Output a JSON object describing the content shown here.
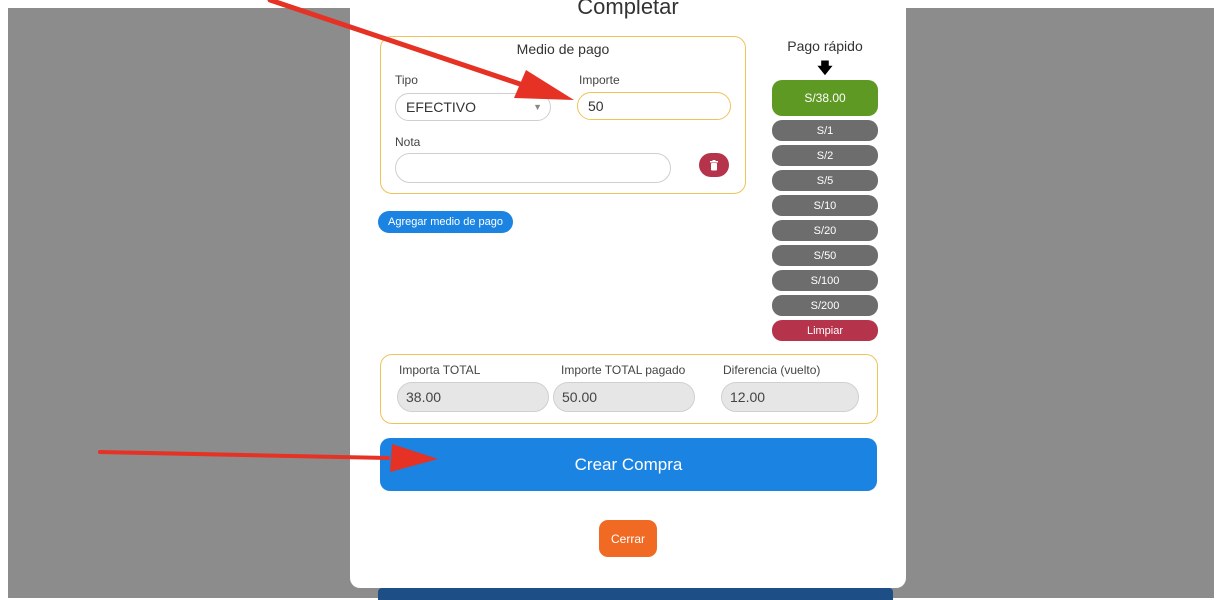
{
  "modal": {
    "title": "Completar",
    "payment_method": {
      "title": "Medio de pago",
      "tipo_label": "Tipo",
      "tipo_value": "EFECTIVO",
      "importe_label": "Importe",
      "importe_value": "50",
      "nota_label": "Nota",
      "nota_value": "",
      "delete_icon": "trash-icon"
    },
    "add_payment_label": "Agregar medio de pago",
    "quick_pay": {
      "title": "Pago rápido",
      "arrow_icon": "arrow-down-icon",
      "primary": "S/38.00",
      "amounts": [
        "S/1",
        "S/2",
        "S/5",
        "S/10",
        "S/20",
        "S/50",
        "S/100",
        "S/200"
      ],
      "clear_label": "Limpiar"
    },
    "totals": {
      "total_label": "Importa TOTAL",
      "total_value": "38.00",
      "paid_label": "Importe TOTAL pagado",
      "paid_value": "50.00",
      "change_label": "Diferencia (vuelto)",
      "change_value": "12.00"
    },
    "create_label": "Crear Compra",
    "close_label": "Cerrar"
  },
  "colors": {
    "accent_blue": "#1b83e2",
    "success_green": "#5e9a23",
    "danger_red": "#b5334b",
    "close_orange": "#f06a23",
    "field_border": "#f0c35a",
    "annotation_arrow": "#e53224"
  }
}
